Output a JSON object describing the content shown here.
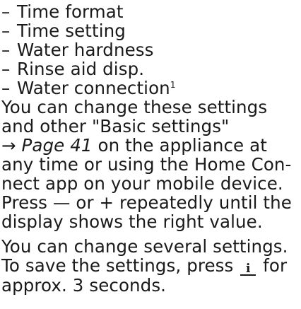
{
  "list": {
    "dash": "–",
    "items": [
      "Time format",
      "Time setting",
      "Water hardness",
      "Rinse aid disp.",
      "Water connection"
    ],
    "footnote_marker": "1"
  },
  "paragraph1": {
    "line1": "You can change these settings",
    "line2": "and other \"Basic settings\"",
    "arrow": "→",
    "page_ref": "Page 41",
    "line3_rest": " on the appliance at",
    "line4": "any time or using the Home Con-",
    "line5": "nect app on your mobile device."
  },
  "paragraph2": {
    "line1_start": "Press ",
    "minus_symbol": "—",
    "line1_mid": " or ",
    "plus_symbol": "+",
    "line1_end": " repeatedly until the",
    "line2": "display shows the right value."
  },
  "paragraph3": {
    "line1": "You can change several settings.",
    "line2_start": "To save the settings, press ",
    "info_icon_glyph": "i",
    "line2_end": " for",
    "line3": "approx. 3 seconds."
  }
}
